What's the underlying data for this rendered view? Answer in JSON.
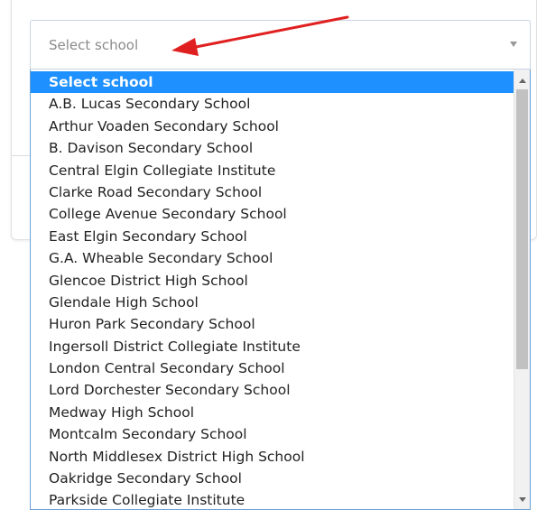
{
  "select": {
    "placeholder": "Select school"
  },
  "options": [
    "Select school",
    "A.B. Lucas Secondary School",
    "Arthur Voaden Secondary School",
    "B. Davison Secondary School",
    "Central Elgin Collegiate Institute",
    "Clarke Road Secondary School",
    "College Avenue Secondary School",
    "East Elgin Secondary School",
    "G.A. Wheable Secondary School",
    "Glencoe District High School",
    "Glendale High School",
    "Huron Park Secondary School",
    "Ingersoll District Collegiate Institute",
    "London Central Secondary School",
    "Lord Dorchester Secondary School",
    "Medway High School",
    "Montcalm Secondary School",
    "North Middlesex District High School",
    "Oakridge Secondary School",
    "Parkside Collegiate Institute"
  ],
  "selected_index": 0,
  "colors": {
    "highlight": "#1e90ff",
    "arrow": "#e02020"
  },
  "icons": {
    "caret": "chevron-down-icon",
    "annotation": "red-arrow-icon"
  }
}
